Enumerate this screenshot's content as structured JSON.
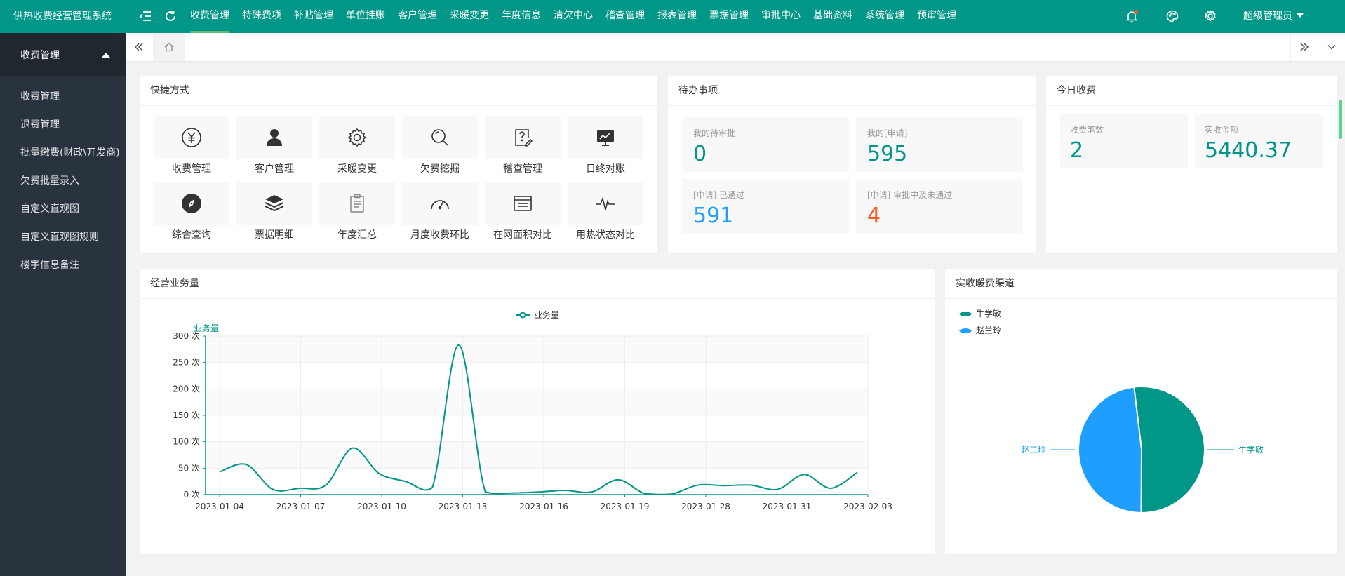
{
  "colors": {
    "primary": "#009688",
    "blue": "#1e9fff",
    "orange": "#ff5722"
  },
  "app": {
    "title": "供热收费经营管理系统"
  },
  "topbar": {
    "menu_icon": "menu-fold-icon",
    "refresh_icon": "refresh-icon",
    "nav": [
      "收费管理",
      "特殊费项",
      "补贴管理",
      "单位挂账",
      "客户管理",
      "采暖变更",
      "年度信息",
      "清欠中心",
      "稽查管理",
      "报表管理",
      "票据管理",
      "审批中心",
      "基础资料",
      "系统管理",
      "预审管理"
    ],
    "active_nav": 0,
    "user": "超级管理员"
  },
  "sidebar": {
    "header": "收费管理",
    "items": [
      {
        "label": "收费管理"
      },
      {
        "label": "退费管理"
      },
      {
        "label": "批量缴费(财政\\开发商)"
      },
      {
        "label": "欠费批量录入"
      },
      {
        "label": "自定义直观图"
      },
      {
        "label": "自定义直观图规则"
      },
      {
        "label": "楼宇信息备注"
      }
    ]
  },
  "quick": {
    "title": "快捷方式",
    "items": [
      {
        "label": "收费管理",
        "icon": "yuan-icon"
      },
      {
        "label": "客户管理",
        "icon": "user-icon"
      },
      {
        "label": "采暖变更",
        "icon": "gear-icon"
      },
      {
        "label": "欠费挖掘",
        "icon": "search-icon"
      },
      {
        "label": "稽查管理",
        "icon": "question-edit-icon"
      },
      {
        "label": "日终对账",
        "icon": "presentation-icon"
      },
      {
        "label": "综合查询",
        "icon": "compass-icon"
      },
      {
        "label": "票据明细",
        "icon": "layers-icon"
      },
      {
        "label": "年度汇总",
        "icon": "clipboard-icon"
      },
      {
        "label": "月度收费环比",
        "icon": "gauge-icon"
      },
      {
        "label": "在网面积对比",
        "icon": "window-icon"
      },
      {
        "label": "用热状态对比",
        "icon": "pulse-icon"
      }
    ]
  },
  "todo": {
    "title": "待办事项",
    "items": [
      {
        "label": "我的待审批",
        "value": "0"
      },
      {
        "label": "我的[申请]",
        "value": "595"
      },
      {
        "label": "[申请] 已通过",
        "value": "591"
      },
      {
        "label": "[申请] 审批中及未通过",
        "value": "4"
      }
    ]
  },
  "today": {
    "title": "今日收费",
    "items": [
      {
        "label": "收费笔数",
        "value": "2"
      },
      {
        "label": "实收金额",
        "value": "5440.37"
      }
    ]
  },
  "business": {
    "title": "经营业务量",
    "chart_data": {
      "type": "line",
      "legend": [
        "业务量"
      ],
      "ylabel": "业务量",
      "y_unit": "次",
      "ylim": [
        0,
        300
      ],
      "y_ticks": [
        "300 次",
        "250 次",
        "200 次",
        "150 次",
        "100 次",
        "50 次",
        "0 次"
      ],
      "x_labels": [
        "2023-01-04",
        "2023-01-07",
        "2023-01-10",
        "2023-01-13",
        "2023-01-16",
        "2023-01-19",
        "2023-01-28",
        "2023-01-31",
        "2023-02-03"
      ],
      "series": [
        {
          "name": "业务量",
          "values": [
            43,
            57,
            10,
            12,
            18,
            88,
            40,
            25,
            13,
            283,
            5,
            3,
            5,
            8,
            5,
            28,
            2,
            1,
            18,
            17,
            18,
            10,
            38,
            12,
            42
          ]
        }
      ],
      "grid": true,
      "legend_position": "top-center"
    }
  },
  "channel": {
    "title": "实收暖费渠道",
    "chart_data": {
      "type": "pie",
      "legend": [
        "牛学敏",
        "赵兰玲"
      ],
      "labels": [
        "牛学敏",
        "赵兰玲"
      ],
      "values": [
        52,
        48
      ],
      "legend_position": "top-left"
    }
  }
}
